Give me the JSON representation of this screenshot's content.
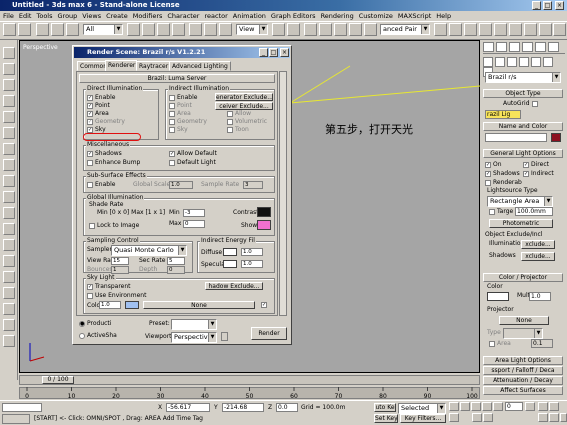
{
  "app": {
    "title": "Untitled - 3ds max 6 - Stand-alone License"
  },
  "menu": [
    "File",
    "Edit",
    "Tools",
    "Group",
    "Views",
    "Create",
    "Modifiers",
    "Character",
    "reactor",
    "Animation",
    "Graph Editors",
    "Rendering",
    "Customize",
    "MAXScript",
    "Help"
  ],
  "toolbar": {
    "selection_filter": "All",
    "view_mode": "View",
    "named_selection": "anced Pair"
  },
  "viewport": {
    "label": "Perspective",
    "annotation": "第五步，打开天光"
  },
  "dialog": {
    "title": "Render Scene: Brazil r/s V1.2.21",
    "tabs": [
      "Common",
      "Renderer",
      "Raytracer",
      "Advanced Lighting"
    ],
    "rollout": "Brazil: Luma Server",
    "direct": {
      "label": "Direct Illumination",
      "enable": "Enable",
      "point": "Point",
      "area": "Area",
      "geometry": "Geometry",
      "sky": "Sky"
    },
    "indirect": {
      "label": "Indirect Illumination",
      "enable": "Enable",
      "point": "Point",
      "area": "Area",
      "geometry": "Geometry",
      "sky": "Sky",
      "gen_exclude": "enerator Exclude...",
      "recv_exclude": "ceiver Exclude...",
      "allow": "Allow",
      "volumetric": "Volumetric",
      "toon": "Toon"
    },
    "misc": {
      "label": "Miscellaneous",
      "shadows": "Shadows",
      "enhance_bump": "Enhance Bump",
      "allow_deflt": "Allow Default",
      "default_light": "Default Light"
    },
    "sss": {
      "label": "Sub-Surface Effects",
      "enable": "Enable",
      "global_scale_label": "Global Scale",
      "global_scale": "1.0",
      "sample_rate_label": "Sample Rate",
      "sample_rate": "3"
    },
    "gi": {
      "label": "Global Illumination",
      "shade_rate": "Shade Rate",
      "minmax": "Min [0 x 0]  Max [1 x 1]",
      "min_label": "Min",
      "min_val": "-3",
      "max_label": "Max",
      "max_val": "0",
      "contrast": "Contrast",
      "lock": "Lock to Image",
      "show": "Show"
    },
    "sampling": {
      "label": "Sampling Control",
      "sampler_label": "Sampler",
      "sampler": "Quasi Monte Carlo",
      "view_rate_label": "View Rate",
      "view_rate": "15",
      "sec_rate_label": "Sec Rate",
      "sec_rate": "5",
      "bounces_label": "Bounces",
      "bounces": "1",
      "depth_label": "Depth",
      "depth": "0"
    },
    "energy": {
      "label": "Indirect Energy Fil",
      "diffuse_label": "Diffuse",
      "diffuse": "1.0",
      "specular_label": "Specular",
      "specular": "1.0"
    },
    "skylight": {
      "label": "Sky Light",
      "transparent": "Transparent",
      "shadow_exclude": "hadow Exclude...",
      "use_env": "Use Environment",
      "color_label": "Color",
      "color_val": "1.0",
      "map": "None"
    },
    "bottom": {
      "production": "Producti",
      "activeshade": "ActiveSha",
      "preset_label": "Preset:",
      "viewport_label": "Viewport:",
      "viewport_val": "Perspective",
      "render": "Render"
    }
  },
  "cmd": {
    "renderer": "Brazil r/s",
    "object_type": "Object Type",
    "autogrid": "AutoGrid",
    "brazil_light": "razil Lig",
    "name_color": "Name and Color",
    "gen_params": "General Light Options",
    "on": "On",
    "direct": "Direct",
    "shadows": "Shadows",
    "indirect": "Indirect",
    "renderable": "Renderab",
    "lightsource": "Lightsource Type",
    "rect_area": "Rectangle Area",
    "target": "Targe",
    "target_val": "100.0mm",
    "photometric": "Photometric",
    "obj_excl": "Object Exclude/Incl",
    "illum_excl": "Illumination",
    "exclude": "xclude...",
    "shadow_excl": "Shadows",
    "color_proj": "Color / Projector",
    "color": "Color",
    "mult": "Mult",
    "mult_val": "1.0",
    "projector": "Projector",
    "none": "None",
    "type": "Type",
    "area": "Area",
    "area_val": "0.1",
    "r1": "Area Light Options",
    "r2": "ssport / Falloff / Deca",
    "r3": "Attenuation / Decay",
    "r4": "Affect Surfaces"
  },
  "time": {
    "slider": "0 / 100",
    "ticks": [
      "0",
      "10",
      "20",
      "30",
      "40",
      "50",
      "60",
      "70",
      "80",
      "90",
      "100"
    ]
  },
  "status": {
    "x": "-56.617",
    "y": "-214.68",
    "z": "0.0",
    "grid": "Grid = 100.0m",
    "auto_key": "uto Ke",
    "selected": "Selected",
    "set_key": "Set Key",
    "key_filters": "Key Filters...",
    "message": "[START]  <- Click: OMNI/SPOT  , Drag: AREA  Add Time Tag",
    "frame": "0"
  },
  "colors": {
    "title": "#0a246a",
    "annotation": "#000000",
    "redmark": "#e01010",
    "viewport": "#a5a5a5"
  }
}
